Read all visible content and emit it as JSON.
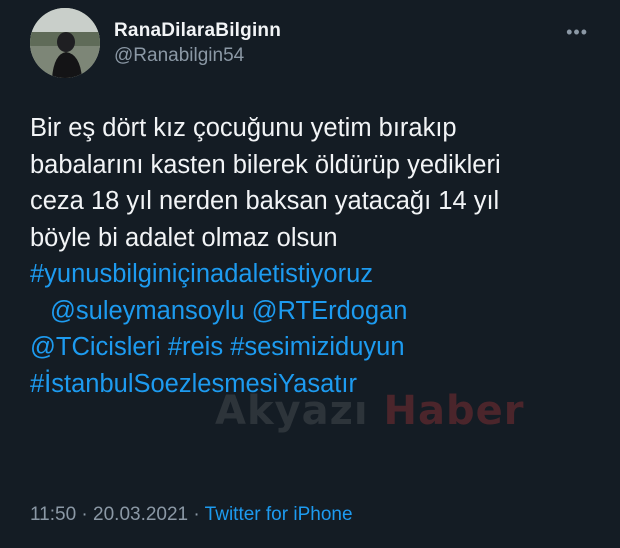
{
  "user": {
    "display_name": "RanaDilaraBilginn",
    "handle": "@Ranabilgin54",
    "more_icon": "more-dots-icon"
  },
  "tweet": {
    "lines": [
      "Bir eş dört kız çocuğunu yetim bırakıp",
      "babalarını kasten bilerek öldürüp yedikleri",
      "ceza 18 yıl nerden baksan yatacağı 14 yıl",
      "böyle bi adalet olmaz olsun"
    ],
    "hashtag_main": "#yunusbilginiçinadaletistiyoruz",
    "mention_1": "@suleymansoylu",
    "mention_2": "@RTErdogan",
    "mention_3": "@TCicisleri",
    "hashtag_2": "#reis",
    "hashtag_3": "#sesimiziduyun",
    "hashtag_4": "#İstanbulSoezlesmesiYasatır"
  },
  "watermark": {
    "part1": "Akyazı ",
    "part2": "Haber"
  },
  "footer": {
    "time": "11:50",
    "sep1": " · ",
    "date": "20.03.2021",
    "sep2": " · ",
    "source": "Twitter for iPhone"
  },
  "colors": {
    "background": "#141c24",
    "text": "#f2f4f6",
    "secondary": "#8b98a5",
    "link": "#1d9bf0"
  }
}
